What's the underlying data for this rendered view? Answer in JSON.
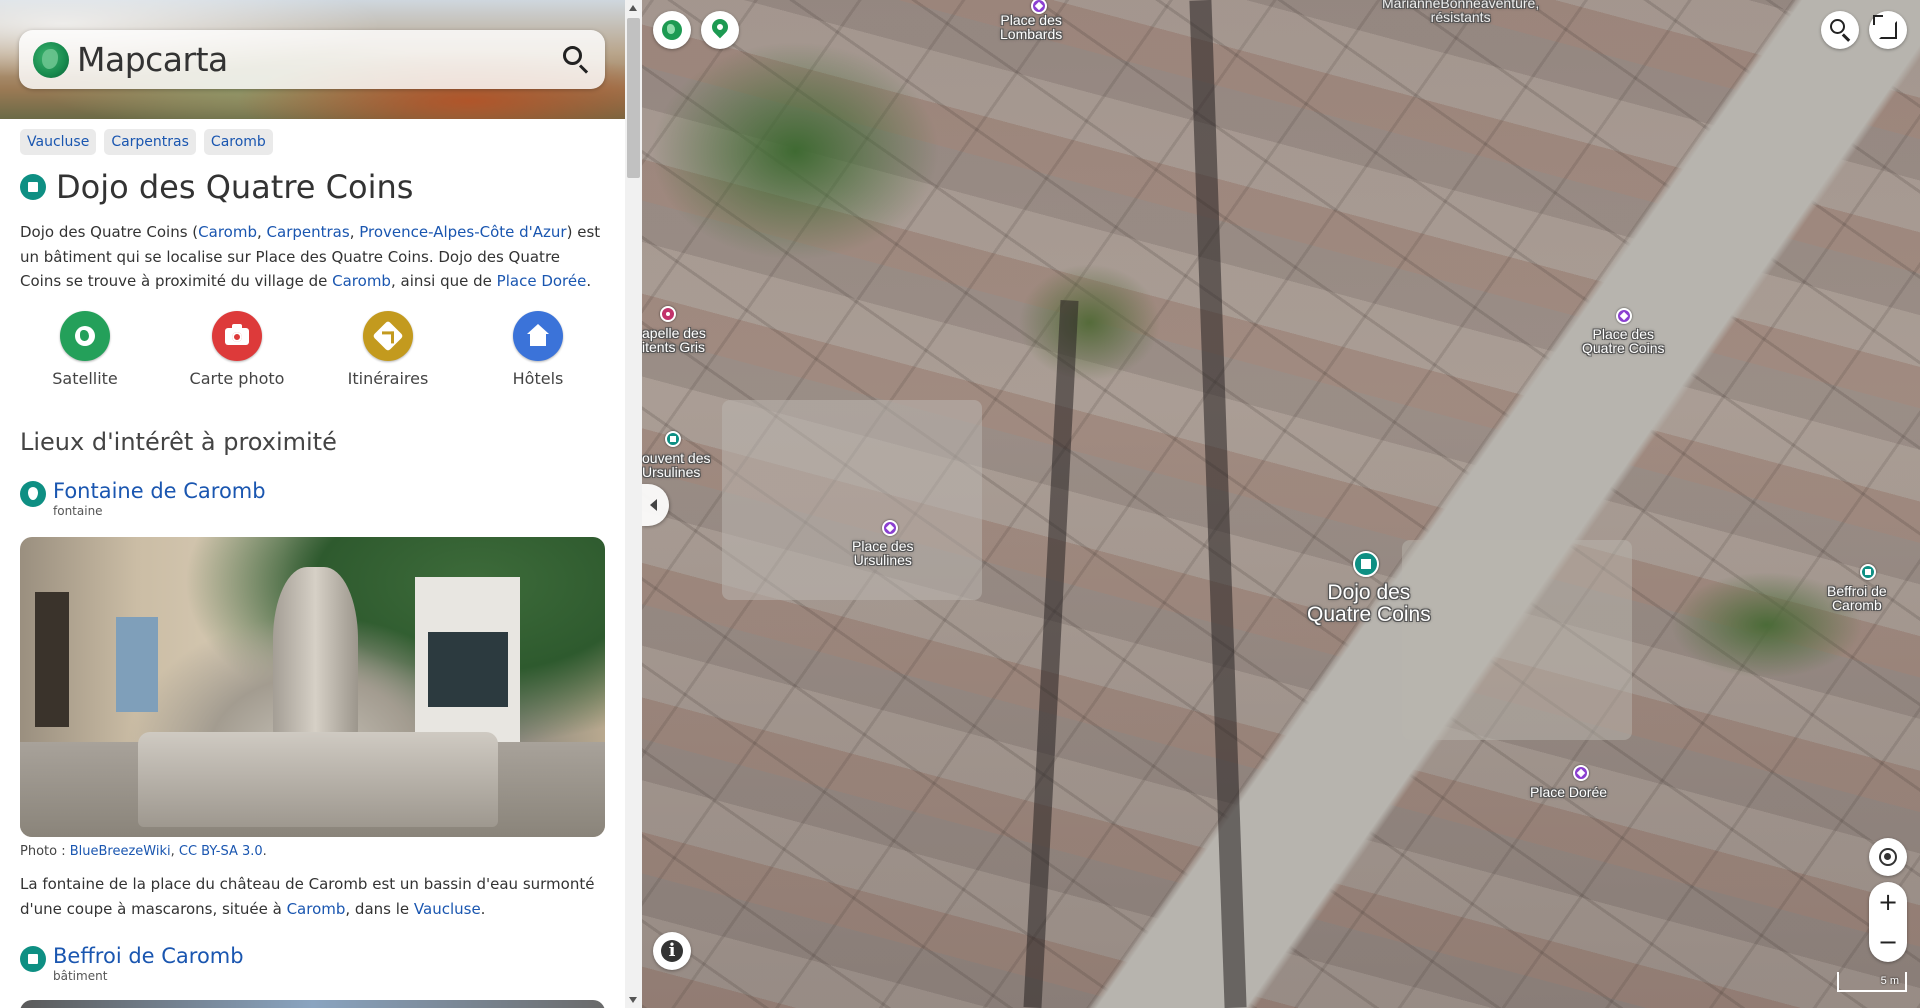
{
  "app": {
    "name": "Mapcarta",
    "search_icon": "search-icon"
  },
  "breadcrumbs": [
    "Vaucluse",
    "Carpentras",
    "Caromb"
  ],
  "place": {
    "title": "Dojo des Quatre Coins",
    "intro": {
      "t1": "Dojo des Quatre Coins (",
      "link1": "Caromb",
      "sep1": ", ",
      "link2": "Carpentras",
      "sep2": ", ",
      "link3": "Provence-Alpes-Côte d'Azur",
      "t2": ") est un bâtiment qui se localise sur Place des Quatre Coins. Dojo des Quatre Coins se trouve à proximité du village de ",
      "link4": "Caromb",
      "t3": ", ainsi que de ",
      "link5": "Place Dorée",
      "t4": "."
    }
  },
  "actions": [
    {
      "label": "Satellite",
      "icon": "globe-icon",
      "color": "#24a05a"
    },
    {
      "label": "Carte photo",
      "icon": "camera-icon",
      "color": "#dd3a3a"
    },
    {
      "label": "Itinéraires",
      "icon": "directions-icon",
      "color": "#c39a1e"
    },
    {
      "label": "Hôtels",
      "icon": "house-icon",
      "color": "#3b73d9"
    }
  ],
  "nearby": {
    "heading": "Lieux d'intérêt à proximité",
    "items": [
      {
        "name": "Fontaine de Caromb",
        "type": "fontaine",
        "photo_credit_prefix": "Photo : ",
        "photo_credit_author": "BlueBreezeWiki",
        "photo_credit_sep": ", ",
        "photo_credit_license": "CC BY-SA 3.0",
        "photo_credit_end": ".",
        "desc_t1": "La fontaine de la place du château de Caromb est un bassin d'eau surmonté d'une coupe à mascarons, située à ",
        "desc_link1": "Caromb",
        "desc_t2": ", dans le ",
        "desc_link2": "Vaucluse",
        "desc_t3": "."
      },
      {
        "name": "Beffroi de Caromb",
        "type": "bâtiment"
      }
    ]
  },
  "map": {
    "labels": {
      "lombards": "Place des\nLombards",
      "marianne": "MarianneBonneaventure,\nrésistants",
      "chapelle": "apelle des\nitents Gris",
      "couvent": "ouvent des\nUrsulines",
      "quatre_coins_place": "Place des\nQuatre Coins",
      "ursulines_place": "Place des\nUrsulines",
      "dojo": "Dojo des\nQuatre Coins",
      "beffroi": "Beffroi de\nCaromb",
      "doree": "Place Dorée"
    },
    "zoom_in": "+",
    "zoom_out": "−",
    "scale": "5 m",
    "accent": "#0e8f83"
  }
}
